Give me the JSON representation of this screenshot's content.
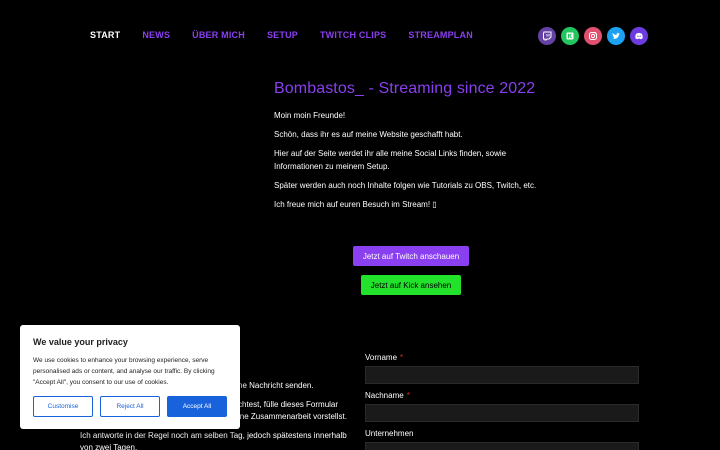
{
  "nav": {
    "items": [
      {
        "label": "START"
      },
      {
        "label": "NEWS"
      },
      {
        "label": "ÜBER MICH"
      },
      {
        "label": "SETUP"
      },
      {
        "label": "TWITCH CLIPS"
      },
      {
        "label": "STREAMPLAN"
      }
    ]
  },
  "socials": {
    "twitch": {
      "icon": "twitch-icon",
      "color": "#6441a5"
    },
    "kick": {
      "icon": "kick-icon",
      "color": "#22c55e"
    },
    "instagram": {
      "icon": "instagram-icon",
      "color": "#e2506f"
    },
    "twitter": {
      "icon": "twitter-icon",
      "color": "#1da1f2"
    },
    "discord": {
      "icon": "discord-icon",
      "color": "#6c3ce0"
    }
  },
  "hero": {
    "title": "Bombastos_ - Streaming since 2022",
    "p1": "Moin moin Freunde!",
    "p2": "Schön, dass ihr es auf meine Website geschafft habt.",
    "p3": "Hier auf der Seite werdet ihr alle meine Social Links finden, sowie Informationen zu meinem Setup.",
    "p4": "Später werden auch noch Inhalte folgen wie Tutorials zu OBS, Twitch, etc.",
    "p5": "Ich freue mich auf euren Besuch im Stream! ▯"
  },
  "buttons": {
    "twitch": "Jetzt auf Twitch anschauen",
    "kick": "Jetzt auf Kick ansehen"
  },
  "contact": {
    "line1": "ne Nachricht senden.",
    "line2": "chtest, fülle dieses Formular",
    "line3": "ine Zusammenarbeit vorstellst.",
    "line4": "Ich antworte in der Regel noch am selben Tag, jedoch spätestens innerhalb von zwei Tagen."
  },
  "form": {
    "first_name": "Vorname",
    "last_name": "Nachname",
    "company": "Unternehmen",
    "required_mark": "*"
  },
  "cookie": {
    "title": "We value your privacy",
    "text": "We use cookies to enhance your browsing experience, serve personalised ads or content, and analyse our traffic. By clicking \"Accept All\", you consent to our use of cookies.",
    "customise": "Customise",
    "reject": "Reject All",
    "accept": "Accept All"
  },
  "colors": {
    "accent": "#8a3ff0",
    "kick": "#22e22c",
    "consent_blue": "#1863dc"
  }
}
